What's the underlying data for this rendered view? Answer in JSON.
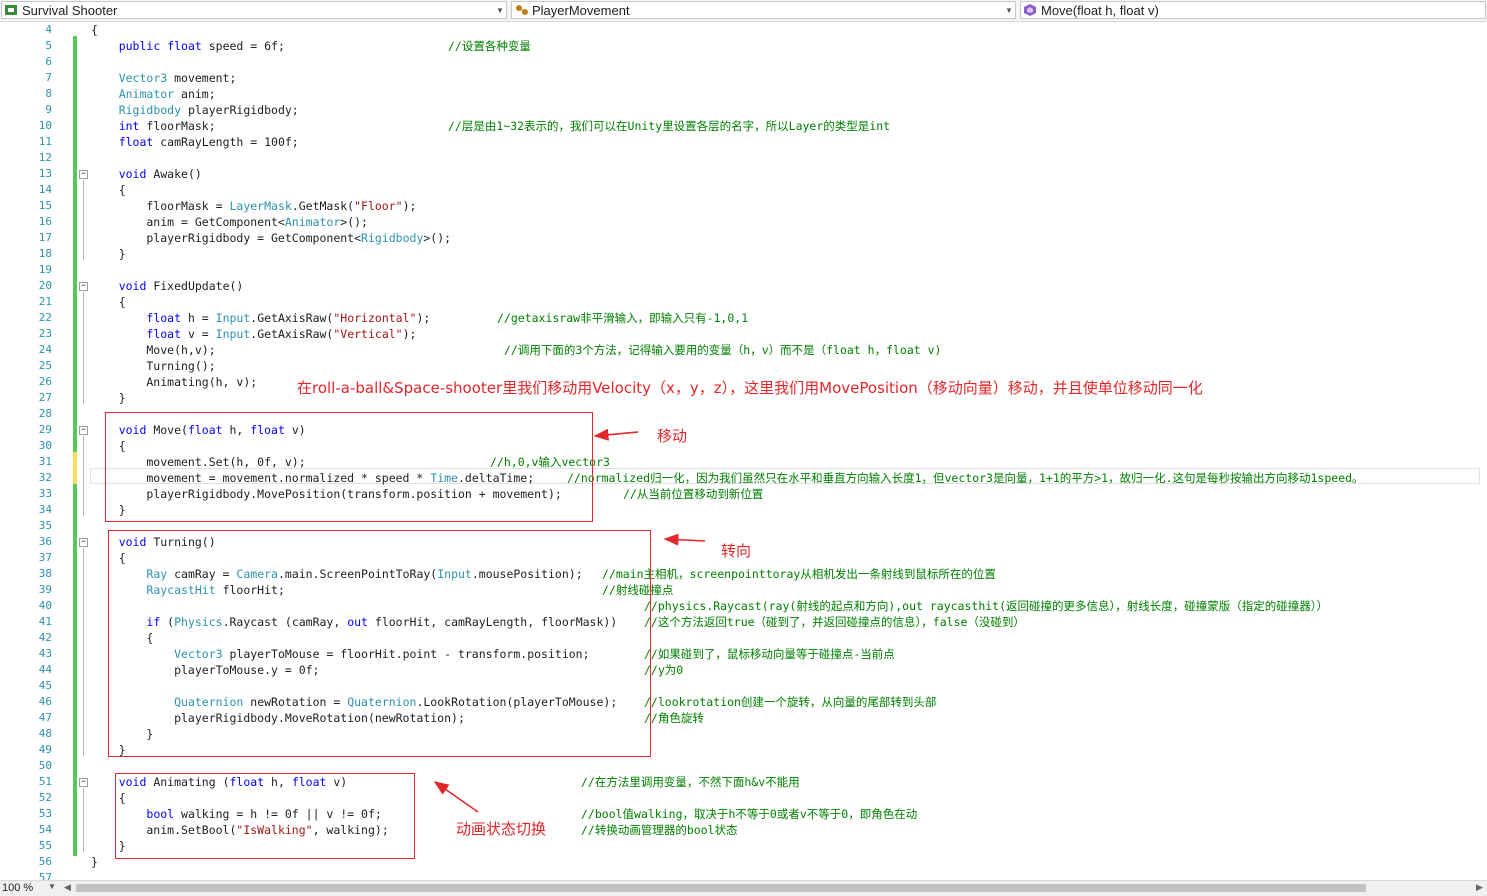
{
  "navbar": {
    "project": "Survival Shooter",
    "class_name": "PlayerMovement",
    "member": "Move(float h, float v)"
  },
  "line_numbers": [
    "4",
    "5",
    "6",
    "7",
    "8",
    "9",
    "10",
    "11",
    "12",
    "13",
    "14",
    "15",
    "16",
    "17",
    "18",
    "19",
    "20",
    "21",
    "22",
    "23",
    "24",
    "25",
    "26",
    "27",
    "28",
    "29",
    "30",
    "31",
    "32",
    "33",
    "34",
    "35",
    "36",
    "37",
    "38",
    "39",
    "40",
    "41",
    "42",
    "43",
    "44",
    "45",
    "46",
    "47",
    "48",
    "49",
    "50",
    "51",
    "52",
    "53",
    "54",
    "55",
    "56",
    "57"
  ],
  "code_lines": [
    [
      [
        "",
        "{"
      ]
    ],
    [
      [
        "",
        "    "
      ],
      [
        "kw",
        "public"
      ],
      [
        "",
        " "
      ],
      [
        "kw",
        "float"
      ],
      [
        "",
        " speed = 6f;"
      ]
    ],
    [],
    [
      [
        "",
        "    "
      ],
      [
        "ty",
        "Vector3"
      ],
      [
        "",
        " movement;"
      ]
    ],
    [
      [
        "",
        "    "
      ],
      [
        "ty",
        "Animator"
      ],
      [
        "",
        " anim;"
      ]
    ],
    [
      [
        "",
        "    "
      ],
      [
        "ty",
        "Rigidbody"
      ],
      [
        "",
        " playerRigidbody;"
      ]
    ],
    [
      [
        "",
        "    "
      ],
      [
        "kw",
        "int"
      ],
      [
        "",
        " floorMask;"
      ]
    ],
    [
      [
        "",
        "    "
      ],
      [
        "kw",
        "float"
      ],
      [
        "",
        " camRayLength = 100f;"
      ]
    ],
    [],
    [
      [
        "",
        "    "
      ],
      [
        "kw",
        "void"
      ],
      [
        "",
        " Awake()"
      ]
    ],
    [
      [
        "",
        "    {"
      ]
    ],
    [
      [
        "",
        "        floorMask = "
      ],
      [
        "ty",
        "LayerMask"
      ],
      [
        "",
        ".GetMask("
      ],
      [
        "st",
        "\"Floor\""
      ],
      [
        "",
        ");"
      ]
    ],
    [
      [
        "",
        "        anim = GetComponent<"
      ],
      [
        "ty",
        "Animator"
      ],
      [
        "",
        ">();"
      ]
    ],
    [
      [
        "",
        "        playerRigidbody = GetComponent<"
      ],
      [
        "ty",
        "Rigidbody"
      ],
      [
        "",
        ">();"
      ]
    ],
    [
      [
        "",
        "    }"
      ]
    ],
    [],
    [
      [
        "",
        "    "
      ],
      [
        "kw",
        "void"
      ],
      [
        "",
        " FixedUpdate()"
      ]
    ],
    [
      [
        "",
        "    {"
      ]
    ],
    [
      [
        "",
        "        "
      ],
      [
        "kw",
        "float"
      ],
      [
        "",
        " h = "
      ],
      [
        "ty",
        "Input"
      ],
      [
        "",
        ".GetAxisRaw("
      ],
      [
        "st",
        "\"Horizontal\""
      ],
      [
        "",
        ");"
      ]
    ],
    [
      [
        "",
        "        "
      ],
      [
        "kw",
        "float"
      ],
      [
        "",
        " v = "
      ],
      [
        "ty",
        "Input"
      ],
      [
        "",
        ".GetAxisRaw("
      ],
      [
        "st",
        "\"Vertical\""
      ],
      [
        "",
        ");"
      ]
    ],
    [
      [
        "",
        "        Move(h,v);"
      ]
    ],
    [
      [
        "",
        "        Turning();"
      ]
    ],
    [
      [
        "",
        "        Animating(h, v);"
      ]
    ],
    [
      [
        "",
        "    }"
      ]
    ],
    [],
    [
      [
        "",
        "    "
      ],
      [
        "kw",
        "void"
      ],
      [
        "",
        " Move("
      ],
      [
        "kw",
        "float"
      ],
      [
        "",
        " h, "
      ],
      [
        "kw",
        "float"
      ],
      [
        "",
        " v)"
      ]
    ],
    [
      [
        "",
        "    {"
      ]
    ],
    [
      [
        "",
        "        movement.Set(h, 0f, v);"
      ]
    ],
    [
      [
        "",
        "        movement = movement.normalized * speed * "
      ],
      [
        "ty",
        "Time"
      ],
      [
        "",
        ".deltaTime;"
      ]
    ],
    [
      [
        "",
        "        playerRigidbody.MovePosition(transform.position + movement);"
      ]
    ],
    [
      [
        "",
        "    }"
      ]
    ],
    [],
    [
      [
        "",
        "    "
      ],
      [
        "kw",
        "void"
      ],
      [
        "",
        " Turning()"
      ]
    ],
    [
      [
        "",
        "    {"
      ]
    ],
    [
      [
        "",
        "        "
      ],
      [
        "ty",
        "Ray"
      ],
      [
        "",
        " camRay = "
      ],
      [
        "ty",
        "Camera"
      ],
      [
        "",
        ".main.ScreenPointToRay("
      ],
      [
        "ty",
        "Input"
      ],
      [
        "",
        ".mousePosition);"
      ]
    ],
    [
      [
        "",
        "        "
      ],
      [
        "ty",
        "RaycastHit"
      ],
      [
        "",
        " floorHit;"
      ]
    ],
    [],
    [
      [
        "",
        "        "
      ],
      [
        "kw",
        "if"
      ],
      [
        "",
        " ("
      ],
      [
        "ty",
        "Physics"
      ],
      [
        "",
        ".Raycast (camRay, "
      ],
      [
        "kw",
        "out"
      ],
      [
        "",
        " floorHit, camRayLength, floorMask))"
      ]
    ],
    [
      [
        "",
        "        {"
      ]
    ],
    [
      [
        "",
        "            "
      ],
      [
        "ty",
        "Vector3"
      ],
      [
        "",
        " playerToMouse = floorHit.point - transform.position;"
      ]
    ],
    [
      [
        "",
        "            playerToMouse.y = 0f;"
      ]
    ],
    [],
    [
      [
        "",
        "            "
      ],
      [
        "ty",
        "Quaternion"
      ],
      [
        "",
        " newRotation = "
      ],
      [
        "ty",
        "Quaternion"
      ],
      [
        "",
        ".LookRotation(playerToMouse);"
      ]
    ],
    [
      [
        "",
        "            playerRigidbody.MoveRotation(newRotation);"
      ]
    ],
    [
      [
        "",
        "        }"
      ]
    ],
    [
      [
        "",
        "    }"
      ]
    ],
    [],
    [
      [
        "",
        "    "
      ],
      [
        "kw",
        "void"
      ],
      [
        "",
        " Animating ("
      ],
      [
        "kw",
        "float"
      ],
      [
        "",
        " h, "
      ],
      [
        "kw",
        "float"
      ],
      [
        "",
        " v)"
      ]
    ],
    [
      [
        "",
        "    {"
      ]
    ],
    [
      [
        "",
        "        "
      ],
      [
        "kw",
        "bool"
      ],
      [
        "",
        " walking = h != 0f || v != 0f;"
      ]
    ],
    [
      [
        "",
        "        anim.SetBool("
      ],
      [
        "st",
        "\"IsWalking\""
      ],
      [
        "",
        ", walking);"
      ]
    ],
    [
      [
        "",
        "    }"
      ]
    ],
    [
      [
        "",
        "}"
      ]
    ],
    []
  ],
  "comments": [
    {
      "line": 5,
      "text": "//设置各种变量"
    },
    {
      "line": 10,
      "text": "//层是由1~32表示的，我们可以在Unity里设置各层的名字，所以Layer的类型是int"
    },
    {
      "line": 22,
      "text": "//getaxisraw非平滑输入，即输入只有-1,0,1"
    },
    {
      "line": 24,
      "text": "//调用下面的3个方法，记得输入要用的变量（h，v）而不是（float h，float v)"
    },
    {
      "line": 31,
      "text": "//h,0,v输入vector3"
    },
    {
      "line": 32,
      "text": "//normalized归一化，因为我们虽然只在水平和垂直方向输入长度1，但vector3是向量，1+1的平方>1，故归一化.这句是每秒按输出方向移动1speed。"
    },
    {
      "line": 33,
      "text": "//从当前位置移动到新位置"
    },
    {
      "line": 38,
      "text": "//main主相机，screenpointtoray从相机发出一条射线到鼠标所在的位置"
    },
    {
      "line": 39,
      "text": "//射线碰撞点"
    },
    {
      "line": 40,
      "text": "//physics.Raycast(ray(射线的起点和方向),out raycasthit(返回碰撞的更多信息），射线长度，碰撞蒙版（指定的碰撞器））"
    },
    {
      "line": 41,
      "text": "//这个方法返回true（碰到了，并返回碰撞点的信息），false（没碰到）"
    },
    {
      "line": 43,
      "text": "//如果碰到了，鼠标移动向量等于碰撞点-当前点"
    },
    {
      "line": 44,
      "text": "//y为0"
    },
    {
      "line": 46,
      "text": "//lookrotation创建一个旋转，从向量的尾部转到头部"
    },
    {
      "line": 47,
      "text": "//角色旋转"
    },
    {
      "line": 51,
      "text": "//在方法里调用变量，不然下面h&v不能用"
    },
    {
      "line": 53,
      "text": "//bool值walking，取决于h不等于0或者v不等于0，即角色在动"
    },
    {
      "line": 54,
      "text": "//转换动画管理器的bool状态"
    }
  ],
  "annotations": {
    "velocity_note": "在roll-a-ball&Space-shooter里我们移动用Velocity（x，y，z），这里我们用MovePosition（移动向量）移动，并且使单位移动同一化",
    "move_label": "移动",
    "turning_label": "转向",
    "animating_label": "动画状态切换"
  },
  "status": {
    "zoom": "100 %"
  },
  "colors": {
    "keyword": "#0000ff",
    "type": "#2b91af",
    "string": "#a31515",
    "comment": "#008000",
    "annotation": "#e3262a",
    "line_number": "#2b91af",
    "changed_marker": "#57c857"
  }
}
